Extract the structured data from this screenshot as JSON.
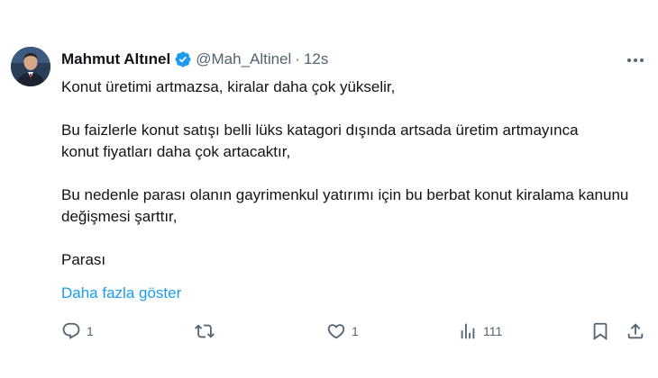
{
  "author": {
    "name": "Mahmut Altınel",
    "handle": "@Mah_Altinel",
    "separator": "·",
    "time": "12s"
  },
  "tweet": {
    "paragraphs": [
      "Konut üretimi artmazsa, kiralar daha çok yükselir,",
      "Bu faizlerle konut satışı belli lüks katagori dışında artsada üretim artmayınca konut fiyatları daha çok artacaktır,",
      "Bu nedenle parası olanın gayrimenkul yatırımı için bu berbat konut kiralama kanunu değişmesi şarttır,",
      "Parası"
    ],
    "show_more": "Daha fazla göster"
  },
  "actions": {
    "replies": "1",
    "retweets": "",
    "likes": "1",
    "views": "111"
  },
  "icons": {
    "verified": "verified-badge-icon",
    "more": "more-options-icon",
    "reply": "reply-icon",
    "retweet": "retweet-icon",
    "like": "heart-icon",
    "views": "views-chart-icon",
    "bookmark": "bookmark-icon",
    "share": "share-icon"
  },
  "colors": {
    "accent": "#1d9bf0",
    "text": "#0f1419",
    "secondary": "#536471"
  }
}
